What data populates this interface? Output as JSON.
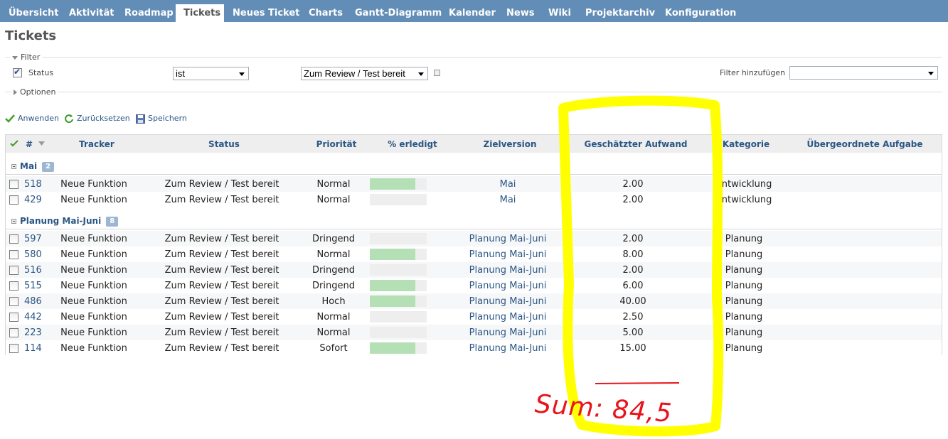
{
  "nav": {
    "items": [
      {
        "label": "Übersicht",
        "selected": false
      },
      {
        "label": "Aktivität",
        "selected": false
      },
      {
        "label": "Roadmap",
        "selected": false
      },
      {
        "label": "Tickets",
        "selected": true
      },
      {
        "label": "Neues Ticket",
        "selected": false
      },
      {
        "label": "Charts",
        "selected": false
      },
      {
        "label": "Gantt-Diagramm",
        "selected": false
      },
      {
        "label": "Kalender",
        "selected": false
      },
      {
        "label": "News",
        "selected": false
      },
      {
        "label": "Wiki",
        "selected": false
      },
      {
        "label": "Projektarchiv",
        "selected": false
      },
      {
        "label": "Konfiguration",
        "selected": false
      }
    ]
  },
  "page": {
    "title": "Tickets"
  },
  "filter": {
    "legend": "Filter",
    "status_label": "Status",
    "operator": "ist",
    "value": "Zum Review / Test bereit",
    "add_filter_label": "Filter hinzufügen",
    "add_filter_value": ""
  },
  "options": {
    "legend": "Optionen"
  },
  "actions": {
    "apply": "Anwenden",
    "reset": "Zurücksetzen",
    "save": "Speichern"
  },
  "table": {
    "headers": {
      "id": "#",
      "tracker": "Tracker",
      "status": "Status",
      "priority": "Priorität",
      "done": "% erledigt",
      "version": "Zielversion",
      "estimate": "Geschätzter Aufwand",
      "category": "Kategorie",
      "parent": "Übergeordnete Aufgabe"
    },
    "groups": [
      {
        "name": "Mai",
        "count": "2",
        "rows": [
          {
            "id": "518",
            "tracker": "Neue Funktion",
            "status": "Zum Review / Test bereit",
            "priority": "Normal",
            "done": 0.8,
            "version": "Mai",
            "estimate": "2.00",
            "category": "Entwicklung"
          },
          {
            "id": "429",
            "tracker": "Neue Funktion",
            "status": "Zum Review / Test bereit",
            "priority": "Normal",
            "done": 0,
            "version": "Mai",
            "estimate": "2.00",
            "category": "Entwicklung"
          }
        ]
      },
      {
        "name": "Planung Mai-Juni",
        "count": "8",
        "rows": [
          {
            "id": "597",
            "tracker": "Neue Funktion",
            "status": "Zum Review / Test bereit",
            "priority": "Dringend",
            "done": 0,
            "version": "Planung Mai-Juni",
            "estimate": "2.00",
            "category": "Planung"
          },
          {
            "id": "580",
            "tracker": "Neue Funktion",
            "status": "Zum Review / Test bereit",
            "priority": "Normal",
            "done": 0.8,
            "version": "Planung Mai-Juni",
            "estimate": "8.00",
            "category": "Planung"
          },
          {
            "id": "516",
            "tracker": "Neue Funktion",
            "status": "Zum Review / Test bereit",
            "priority": "Dringend",
            "done": 0,
            "version": "Planung Mai-Juni",
            "estimate": "2.00",
            "category": "Planung"
          },
          {
            "id": "515",
            "tracker": "Neue Funktion",
            "status": "Zum Review / Test bereit",
            "priority": "Dringend",
            "done": 0.8,
            "version": "Planung Mai-Juni",
            "estimate": "6.00",
            "category": "Planung"
          },
          {
            "id": "486",
            "tracker": "Neue Funktion",
            "status": "Zum Review / Test bereit",
            "priority": "Hoch",
            "done": 0.8,
            "version": "Planung Mai-Juni",
            "estimate": "40.00",
            "category": "Planung"
          },
          {
            "id": "442",
            "tracker": "Neue Funktion",
            "status": "Zum Review / Test bereit",
            "priority": "Normal",
            "done": 0,
            "version": "Planung Mai-Juni",
            "estimate": "2.50",
            "category": "Planung"
          },
          {
            "id": "223",
            "tracker": "Neue Funktion",
            "status": "Zum Review / Test bereit",
            "priority": "Normal",
            "done": 0,
            "version": "Planung Mai-Juni",
            "estimate": "5.00",
            "category": "Planung"
          },
          {
            "id": "114",
            "tracker": "Neue Funktion",
            "status": "Zum Review / Test bereit",
            "priority": "Sofort",
            "done": 0.8,
            "version": "Planung Mai-Juni",
            "estimate": "15.00",
            "category": "Planung"
          }
        ]
      }
    ]
  },
  "annotation": {
    "text": "Sum: 84,5",
    "highlight_color": "#ffff00",
    "ink_color": "#ff0000"
  }
}
